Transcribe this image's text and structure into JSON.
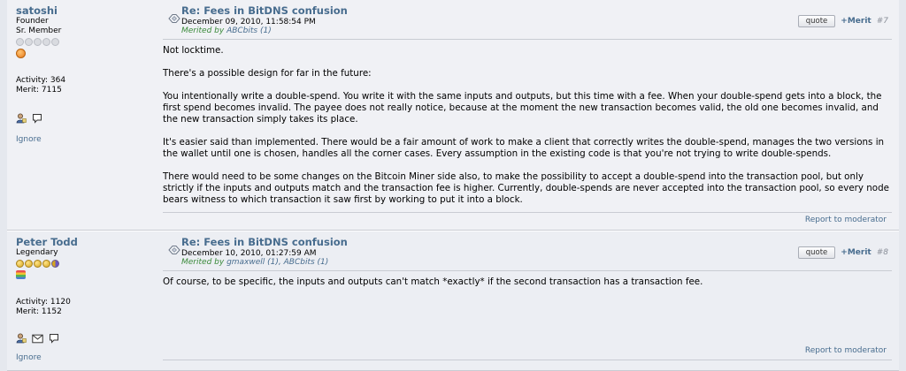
{
  "posts": [
    {
      "poster": {
        "name": "satoshi",
        "title": "Founder",
        "rank": "Sr. Member",
        "activity": "Activity: 364",
        "merit": "Merit: 7115",
        "ignore": "Ignore"
      },
      "subject": "Re: Fees in BitDNS confusion",
      "date": "December 09, 2010, 11:58:54 PM",
      "merited_prefix": "Merited by",
      "merited_users": "ABCbits (1)",
      "quote_label": "quote",
      "merit_label": "+Merit",
      "post_number": "#7",
      "paragraphs": [
        "Not locktime.",
        "There's a possible design for far in the future:",
        "You intentionally write a double-spend.  You write it with the same inputs and outputs, but this time with a fee.  When your double-spend gets into a block, the first spend becomes invalid.  The payee does not really notice, because at the moment the new transaction becomes valid, the old one becomes invalid, and the new transaction simply takes its place.",
        "It's easier said than implemented.  There would be a fair amount of work to make a client that correctly writes the double-spend, manages the two versions in the wallet until one is chosen, handles all the corner cases.  Every assumption in the existing code is that you're not trying to write double-spends.",
        "There would need to be some changes on the Bitcoin Miner side also, to make the possibility to accept a double-spend into the transaction pool, but only strictly if the inputs and outputs match and the transaction fee is higher.  Currently, double-spends are never accepted into the transaction pool, so every node bears witness to which transaction it saw first by working to put it into a block."
      ],
      "report": "Report to moderator"
    },
    {
      "poster": {
        "name": "Peter Todd",
        "rank": "Legendary",
        "activity": "Activity: 1120",
        "merit": "Merit: 1152",
        "ignore": "Ignore"
      },
      "subject": "Re: Fees in BitDNS confusion",
      "date": "December 10, 2010, 01:27:59 AM",
      "merited_prefix": "Merited by",
      "merited_users": "gmaxwell (1), ABCbits (1)",
      "quote_label": "quote",
      "merit_label": "+Merit",
      "post_number": "#8",
      "paragraphs": [
        "Of course, to be specific, the inputs and outputs can't match *exactly* if the second transaction has a transaction fee."
      ],
      "report": "Report to moderator"
    }
  ],
  "colors": {
    "link": "#476c8e",
    "merited": "#3a8a3a",
    "background": "#e5e8ee"
  },
  "icons": {
    "topic": "topic-diamond-icon",
    "profile": "profile-icon",
    "message": "message-icon",
    "speech": "speech-bubble-icon"
  }
}
